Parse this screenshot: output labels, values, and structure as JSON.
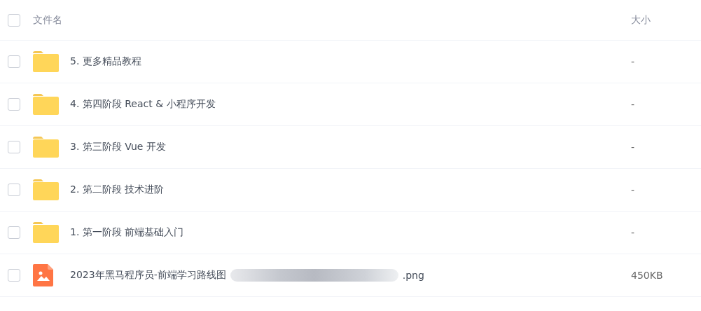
{
  "table": {
    "select_all": {
      "checked": false
    },
    "columns": [
      "文件名",
      "大小"
    ],
    "rows": [
      {
        "kind": "folder",
        "name": "5. 更多精品教程",
        "size": "-",
        "checked": false
      },
      {
        "kind": "folder",
        "name": "4. 第四阶段 React & 小程序开发",
        "size": "-",
        "checked": false
      },
      {
        "kind": "folder",
        "name": "3. 第三阶段 Vue 开发",
        "size": "-",
        "checked": false
      },
      {
        "kind": "folder",
        "name": "2. 第二阶段 技术进阶",
        "size": "-",
        "checked": false
      },
      {
        "kind": "folder",
        "name": "1. 第一阶段 前端基础入门",
        "size": "-",
        "checked": false
      },
      {
        "kind": "image",
        "name": "2023年黑马程序员-前端学习路线图",
        "redacted": true,
        "name_suffix": ".png",
        "size": "450KB",
        "checked": false
      }
    ]
  }
}
